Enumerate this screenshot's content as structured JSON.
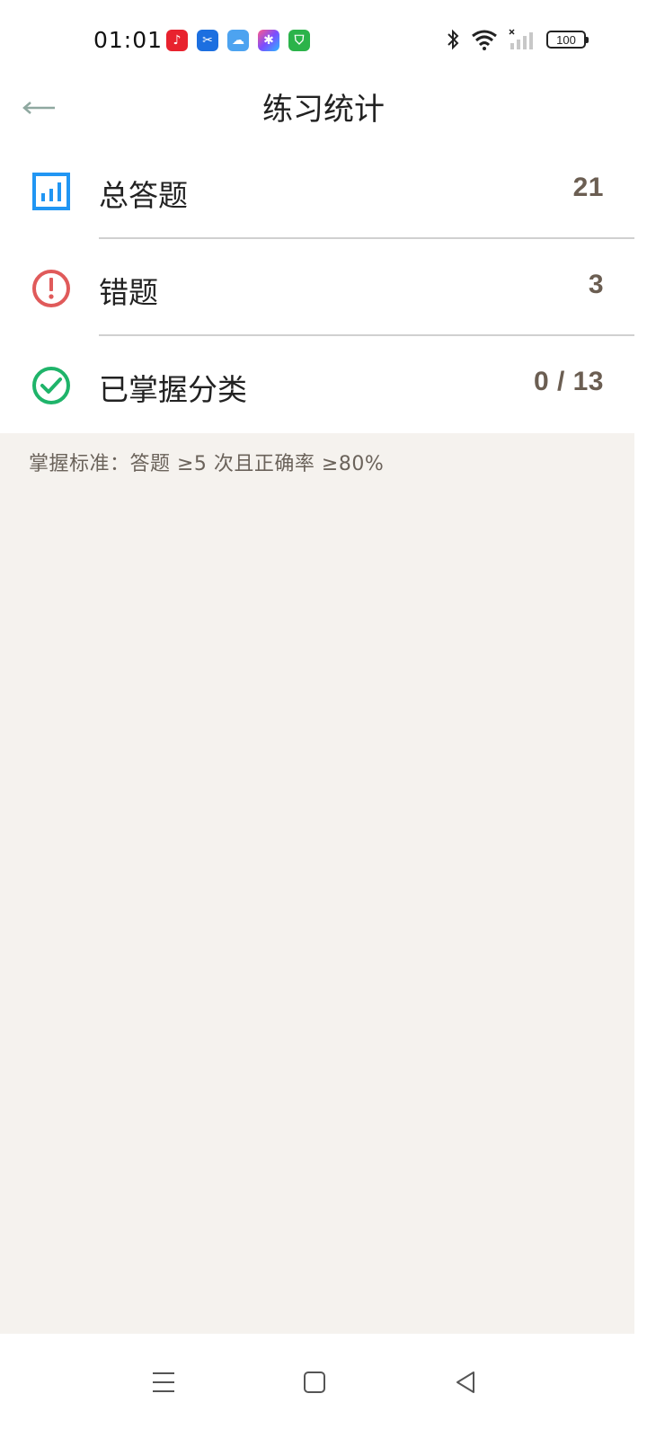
{
  "status_bar": {
    "time": "01:01",
    "battery": "100",
    "app_icons": [
      "music-app-icon",
      "scissors-app-icon",
      "weather-app-icon",
      "photos-app-icon",
      "security-app-icon"
    ]
  },
  "header": {
    "title": "练习统计",
    "back_icon": "back-arrow-icon"
  },
  "stats": [
    {
      "label": "总答题",
      "value": "21",
      "icon": "bar-chart-icon",
      "color": "#2196f3"
    },
    {
      "label": "错题",
      "value": "3",
      "icon": "alert-circle-icon",
      "color": "#e05a5a"
    },
    {
      "label": "已掌握分类",
      "value": "0 / 13",
      "icon": "check-circle-icon",
      "color": "#1fb46a"
    }
  ],
  "mastery_note": "掌握标准：答题 ≥5 次且正确率 ≥80%",
  "nav_bar": {
    "items": [
      "menu-icon",
      "home-icon",
      "back-icon"
    ]
  },
  "colors": {
    "value_text": "#6b5e52",
    "content_bg": "#f5f2ee",
    "back_arrow": "#8fa8a0"
  }
}
